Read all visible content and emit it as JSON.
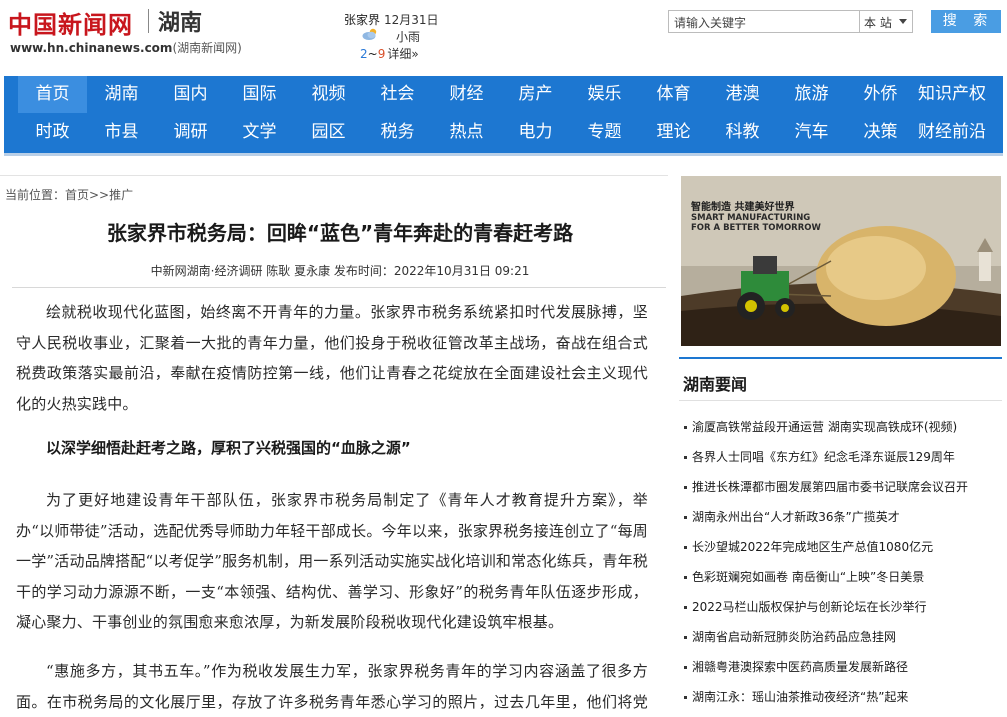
{
  "header": {
    "logo_main": "中国新闻网",
    "logo_region": "湖南",
    "logo_url": "www.hn.chinanews.com",
    "logo_sub": "(湖南新闻网)"
  },
  "weather": {
    "city": "张家界",
    "date": "12月31日",
    "icon": "cloud-rain-icon",
    "desc": "小雨",
    "temp_low": "2",
    "temp_sep": "~",
    "temp_high": "9",
    "more": "详细»"
  },
  "search": {
    "placeholder": "请输入关键字",
    "scope": "本 站",
    "button": "搜 索"
  },
  "nav": {
    "row1": [
      "首页",
      "湖南",
      "国内",
      "国际",
      "视频",
      "社会",
      "财经",
      "房产",
      "娱乐",
      "体育",
      "港澳",
      "旅游",
      "外侨",
      "知识产权"
    ],
    "row2": [
      "时政",
      "市县",
      "调研",
      "文学",
      "园区",
      "税务",
      "热点",
      "电力",
      "专题",
      "理论",
      "科教",
      "汽车",
      "决策",
      "财经前沿"
    ],
    "active": "首页"
  },
  "breadcrumb": "当前位置：首页>>推广",
  "article": {
    "title": "张家界市税务局：回眸“蓝色”青年奔赴的青春赶考路",
    "meta": "中新网湖南·经济调研 陈耿 夏永康 发布时间：2022年10月31日 09:21",
    "p1": "绘就税收现代化蓝图，始终离不开青年的力量。张家界市税务系统紧扣时代发展脉搏，坚守人民税收事业，汇聚着一大批的青年力量，他们投身于税收征管改革主战场，奋战在组合式税费政策落实最前沿，奉献在疫情防控第一线，他们让青春之花绽放在全面建设社会主义现代化的火热实践中。",
    "subhead": "以深学细悟赴赶考之路，厚积了兴税强国的“血脉之源”",
    "p2": "为了更好地建设青年干部队伍，张家界市税务局制定了《青年人才教育提升方案》，举办“以师带徒”活动，选配优秀导师助力年轻干部成长。今年以来，张家界税务接连创立了“每周一学”活动品牌搭配“以考促学”服务机制，用一系列活动实施实战化培训和常态化练兵，青年税干的学习动力源源不断，一支“本领强、结构优、善学习、形象好”的税务青年队伍逐步形成，凝心聚力、干事创业的氛围愈来愈浓厚，为新发展阶段税收现代化建设筑牢根基。",
    "p3": "“惠施多方，其书五车。”作为税收发展生力军，张家界税务青年的学习内容涵盖了很多方面。在市税务局的文化展厅里，存放了许多税务青年悉心学习的照片，过去几年里，他们将党的"
  },
  "ad": {
    "line1": "智能制造 共建美好世界",
    "line2": "SMART MANUFACTURING",
    "line3": "FOR A BETTER TOMORROW"
  },
  "sidebar": {
    "heading": "湖南要闻",
    "items": [
      "渝厦高铁常益段开通运营 湖南实现高铁成环(视频)",
      "各界人士同唱《东方红》纪念毛泽东诞辰129周年",
      "推进长株潭都市圈发展第四届市委书记联席会议召开",
      "湖南永州出台“人才新政36条”广揽英才",
      "长沙望城2022年完成地区生产总值1080亿元",
      "色彩斑斓宛如画卷 南岳衡山“上映”冬日美景",
      "2022马栏山版权保护与创新论坛在长沙举行",
      "湖南省启动新冠肺炎防治药品应急挂网",
      "湘赣粤港澳探索中医药高质量发展新路径",
      "湖南江永：瑶山油茶推动夜经济“热”起来"
    ]
  },
  "colors": {
    "nav_bg": "#1d77d1",
    "logo_red": "#c8161d",
    "search_btn": "#4a9de3"
  }
}
